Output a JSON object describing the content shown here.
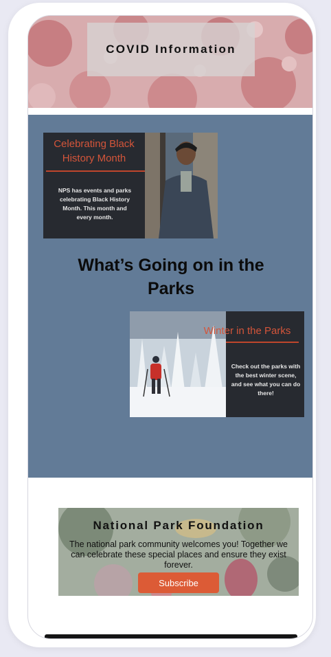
{
  "covid_banner": {
    "label": "COVID Information"
  },
  "parks_section": {
    "heading": "What’s Going on in the Parks",
    "black_history_card": {
      "title": "Celebrating Black History Month",
      "body": "NPS has events and parks celebrating Black History Month. This month and every month."
    },
    "winter_card": {
      "title": "Winter in the Parks",
      "body": "Check out the parks with the best winter scene, and see what you can do there!"
    }
  },
  "npf_banner": {
    "title": "National Park Foundation",
    "text": "The national park community welcomes you! Together we can celebrate these special places and ensure they exist forever.",
    "button_label": "Subscribe"
  },
  "colors": {
    "section_bg": "#627b97",
    "card_bg": "#272a30",
    "card_accent": "#d4553a",
    "button": "#dc5b36"
  }
}
